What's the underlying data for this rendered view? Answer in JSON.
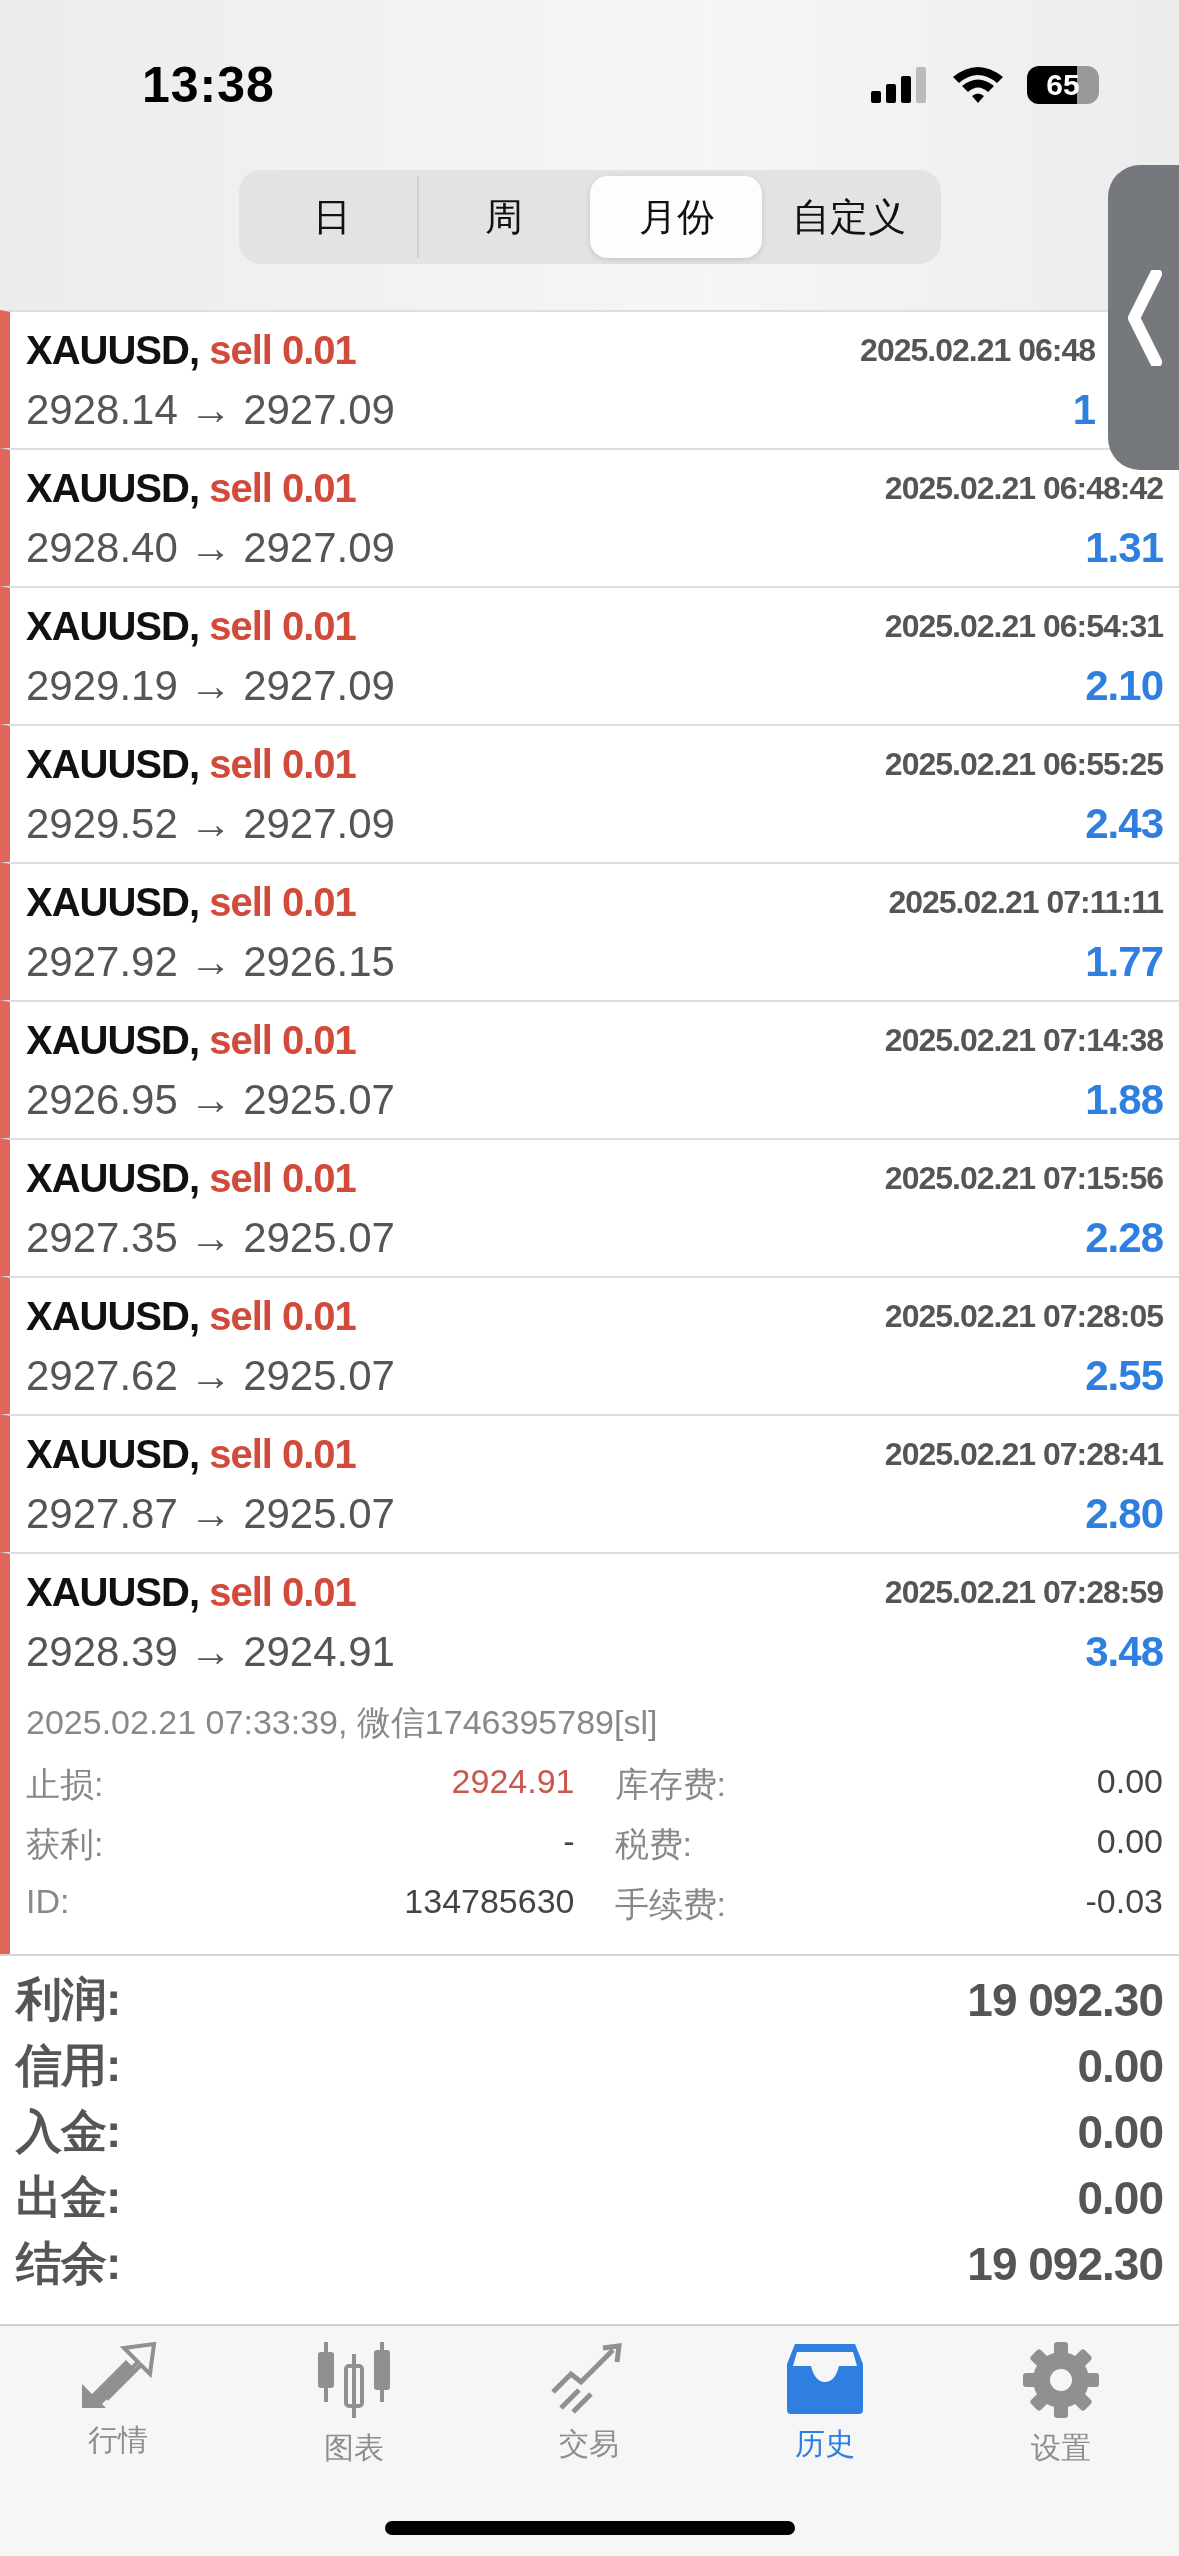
{
  "status_bar": {
    "time": "13:38",
    "battery": "65"
  },
  "tabs": [
    {
      "label": "日",
      "selected": false
    },
    {
      "label": "周",
      "selected": false
    },
    {
      "label": "月份",
      "selected": true
    },
    {
      "label": "自定义",
      "selected": false
    }
  ],
  "trades": [
    {
      "symbol": "XAUUSD,",
      "order": "sell 0.01",
      "prices": "2928.14 → 2927.09",
      "time": "2025.02.21 06:48",
      "profit": "1"
    },
    {
      "symbol": "XAUUSD,",
      "order": "sell 0.01",
      "prices": "2928.40 → 2927.09",
      "time": "2025.02.21 06:48:42",
      "profit": "1.31"
    },
    {
      "symbol": "XAUUSD,",
      "order": "sell 0.01",
      "prices": "2929.19 → 2927.09",
      "time": "2025.02.21 06:54:31",
      "profit": "2.10"
    },
    {
      "symbol": "XAUUSD,",
      "order": "sell 0.01",
      "prices": "2929.52 → 2927.09",
      "time": "2025.02.21 06:55:25",
      "profit": "2.43"
    },
    {
      "symbol": "XAUUSD,",
      "order": "sell 0.01",
      "prices": "2927.92 → 2926.15",
      "time": "2025.02.21 07:11:11",
      "profit": "1.77"
    },
    {
      "symbol": "XAUUSD,",
      "order": "sell 0.01",
      "prices": "2926.95 → 2925.07",
      "time": "2025.02.21 07:14:38",
      "profit": "1.88"
    },
    {
      "symbol": "XAUUSD,",
      "order": "sell 0.01",
      "prices": "2927.35 → 2925.07",
      "time": "2025.02.21 07:15:56",
      "profit": "2.28"
    },
    {
      "symbol": "XAUUSD,",
      "order": "sell 0.01",
      "prices": "2927.62 → 2925.07",
      "time": "2025.02.21 07:28:05",
      "profit": "2.55"
    },
    {
      "symbol": "XAUUSD,",
      "order": "sell 0.01",
      "prices": "2927.87 → 2925.07",
      "time": "2025.02.21 07:28:41",
      "profit": "2.80"
    },
    {
      "symbol": "XAUUSD,",
      "order": "sell 0.01",
      "prices": "2928.39 → 2924.91",
      "time": "2025.02.21 07:28:59",
      "profit": "3.48",
      "detail": {
        "comment": "2025.02.21 07:33:39, 微信1746395789[sl]",
        "fields": [
          {
            "label": "止损:",
            "value": "2924.91",
            "color": "#c9574c"
          },
          {
            "label": "库存费:",
            "value": "0.00"
          },
          {
            "label": "获利:",
            "value": "-"
          },
          {
            "label": "税费:",
            "value": "0.00"
          },
          {
            "label": "ID:",
            "value": "134785630"
          },
          {
            "label": "手续费:",
            "value": "-0.03"
          }
        ]
      }
    }
  ],
  "summary": [
    {
      "label": "利润:",
      "value": "19 092.30"
    },
    {
      "label": "信用:",
      "value": "0.00"
    },
    {
      "label": "入金:",
      "value": "0.00"
    },
    {
      "label": "出金:",
      "value": "0.00"
    },
    {
      "label": "结余:",
      "value": "19 092.30"
    }
  ],
  "nav": [
    {
      "label": "行情",
      "kind": "quotes",
      "selected": false
    },
    {
      "label": "图表",
      "kind": "chart",
      "selected": false
    },
    {
      "label": "交易",
      "kind": "trade",
      "selected": false
    },
    {
      "label": "历史",
      "kind": "history",
      "selected": true
    },
    {
      "label": "设置",
      "kind": "settings",
      "selected": false
    }
  ]
}
